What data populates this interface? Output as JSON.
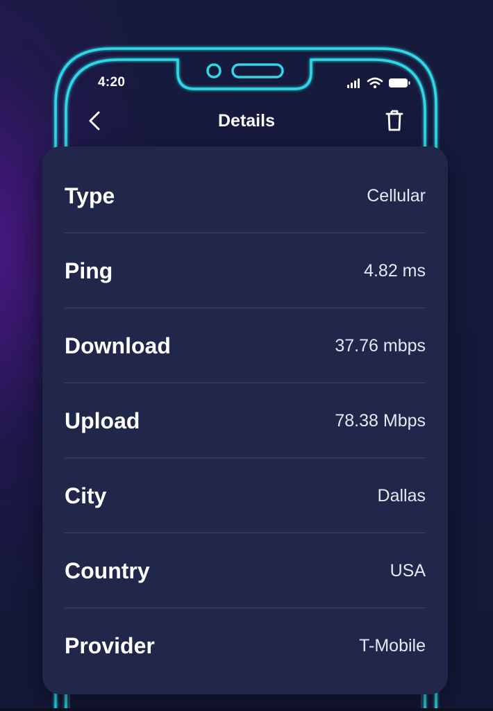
{
  "status_bar": {
    "time": "4:20",
    "icons": [
      "signal-icon",
      "wifi-icon",
      "battery-icon"
    ]
  },
  "nav": {
    "back_icon": "chevron-left-icon",
    "title": "Details",
    "delete_icon": "trash-icon"
  },
  "details": {
    "rows": [
      {
        "label": "Type",
        "value": "Cellular"
      },
      {
        "label": "Ping",
        "value": "4.82 ms"
      },
      {
        "label": "Download",
        "value": "37.76 mbps"
      },
      {
        "label": "Upload",
        "value": "78.38 Mbps"
      },
      {
        "label": "City",
        "value": "Dallas"
      },
      {
        "label": "Country",
        "value": "USA"
      },
      {
        "label": "Provider",
        "value": "T-Mobile"
      }
    ]
  },
  "colors": {
    "background": "#14183a",
    "accent_glow": "#5f16a0",
    "phone_outline": "#2fd8e6",
    "card": "#21274a",
    "divider": "#3d4466",
    "text": "#ffffff"
  }
}
